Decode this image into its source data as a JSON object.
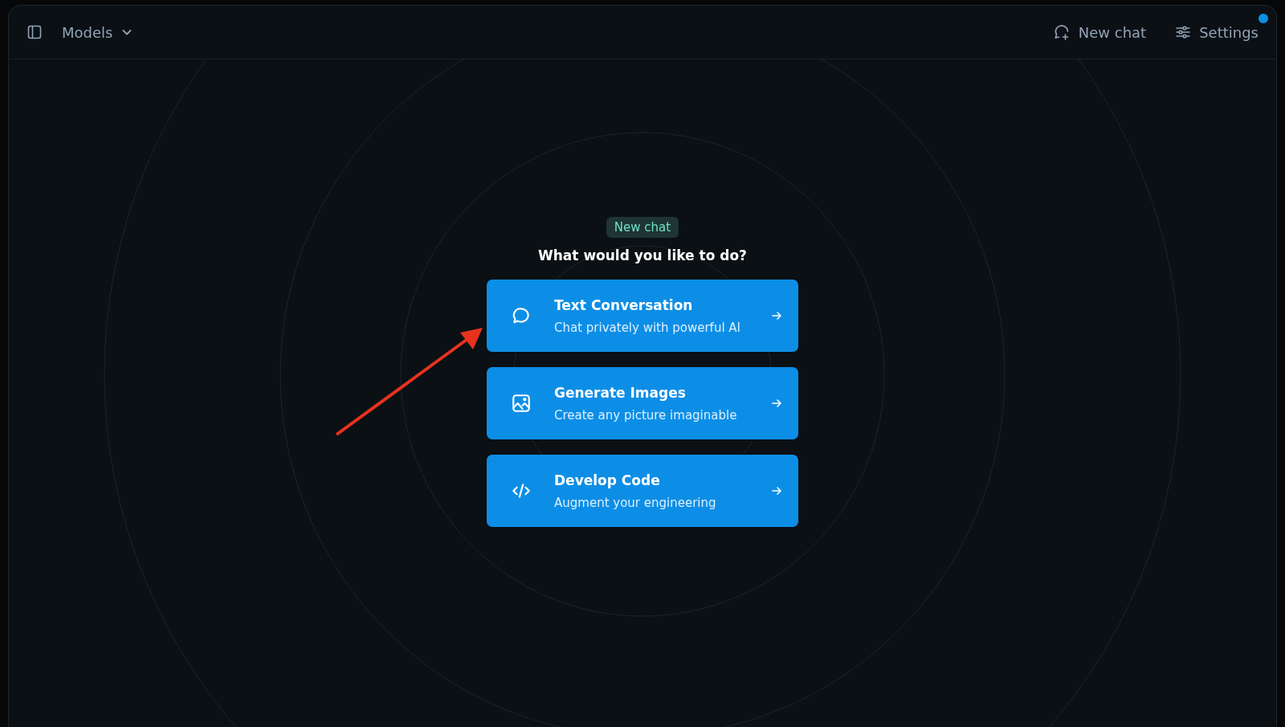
{
  "header": {
    "models_label": "Models",
    "new_chat": "New chat",
    "settings": "Settings"
  },
  "badge": "New chat",
  "heading": "What would you like to do?",
  "options": [
    {
      "kind": "chat",
      "title": "Text Conversation",
      "subtitle": "Chat privately with powerful AI"
    },
    {
      "kind": "image",
      "title": "Generate Images",
      "subtitle": "Create any picture imaginable"
    },
    {
      "kind": "code",
      "title": "Develop Code",
      "subtitle": "Augment your engineering"
    }
  ]
}
